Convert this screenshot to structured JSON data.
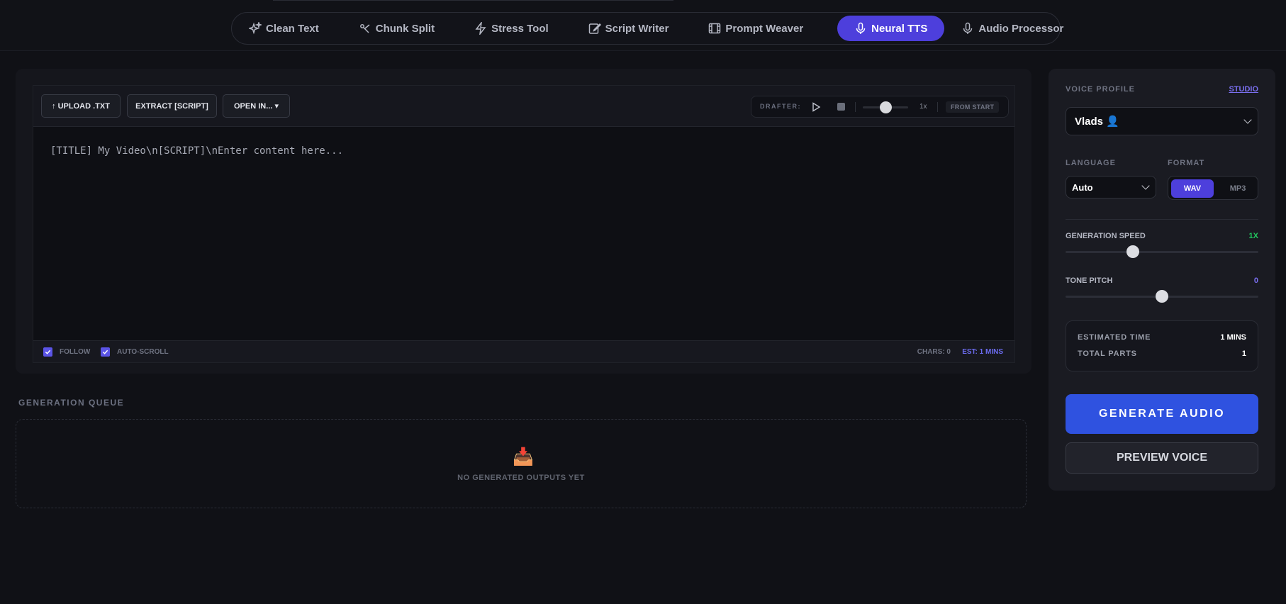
{
  "nav": {
    "items": [
      {
        "label": "Clean Text",
        "icon": "sparkles-icon"
      },
      {
        "label": "Chunk Split",
        "icon": "split-icon"
      },
      {
        "label": "Stress Tool",
        "icon": "lightning-icon"
      },
      {
        "label": "Script Writer",
        "icon": "pencil-icon"
      },
      {
        "label": "Prompt Weaver",
        "icon": "film-icon"
      },
      {
        "label": "Neural TTS",
        "icon": "microphone-icon",
        "active": true
      },
      {
        "label": "Audio Processor",
        "icon": "microphone-icon"
      }
    ]
  },
  "toolbar": {
    "upload_label": "↑ UPLOAD .TXT",
    "extract_label": "EXTRACT [SCRIPT]",
    "open_label": "OPEN IN... ▾",
    "drafter_label": "DRAFTER:",
    "rate": "1x",
    "from_start_label": "FROM START"
  },
  "editor": {
    "placeholder": "[TITLE] My Video\\n[SCRIPT]\\nEnter content here..."
  },
  "footer": {
    "follow_label": "FOLLOW",
    "autoscroll_label": "AUTO-SCROLL",
    "chars": "CHARS: 0",
    "est": "EST: 1 MINS"
  },
  "queue": {
    "title": "GENERATION QUEUE",
    "empty_icon": "📥",
    "empty_text": "NO GENERATED OUTPUTS YET"
  },
  "side": {
    "voice_profile_label": "VOICE PROFILE",
    "studio_link": "STUDIO",
    "voice_value": "Vlads 👤",
    "language_label": "LANGUAGE",
    "language_value": "Auto",
    "format_label": "FORMAT",
    "format_options": [
      "WAV",
      "MP3"
    ],
    "format_selected": "WAV",
    "speed_label": "GENERATION SPEED",
    "speed_value": "1X",
    "speed_fraction": 0.35,
    "pitch_label": "TONE PITCH",
    "pitch_value": "0",
    "pitch_fraction": 0.5,
    "estimated_time_label": "ESTIMATED TIME",
    "estimated_time_value": "1 MINS",
    "total_parts_label": "TOTAL PARTS",
    "total_parts_value": "1",
    "generate_label": "GENERATE AUDIO",
    "preview_label": "PREVIEW VOICE"
  },
  "colors": {
    "accent": "#4d3fdc",
    "generate": "#2f52e0",
    "speed_value": "#22c55e",
    "pitch_value": "#7a6ff0"
  }
}
